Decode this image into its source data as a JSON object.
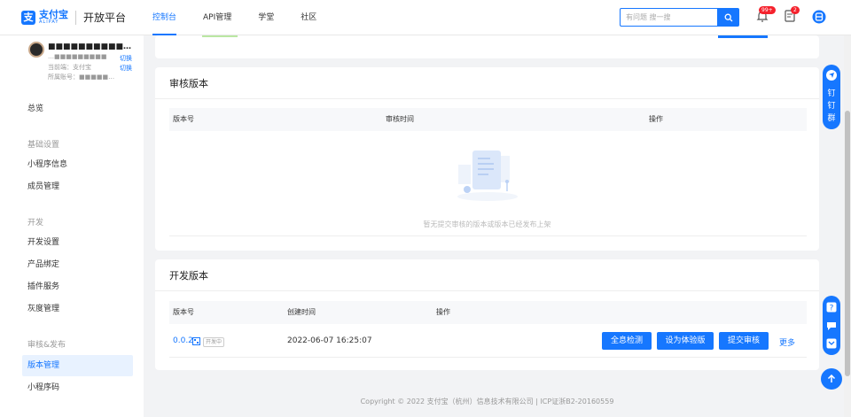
{
  "header": {
    "logo_cn": "支付宝",
    "logo_en": "ALIPAY",
    "platform": "开放平台",
    "nav": [
      "控制台",
      "API管理",
      "学堂",
      "社区"
    ],
    "search_placeholder": "有问题 搜一搜",
    "notification_badge": "99+",
    "message_badge": "2"
  },
  "sidebar": {
    "user_name": "■■■■■■■■■■…",
    "user_sub": "…■■■■■■■■■",
    "current_end_label": "当前端：支付宝",
    "account_label": "所属账号：■■■■■…",
    "switch_label": "切换",
    "overview": "总览",
    "groups": [
      "基础设置",
      "开发",
      "审核&发布"
    ],
    "items_basic": [
      "小程序信息",
      "成员管理"
    ],
    "items_dev": [
      "开发设置",
      "产品绑定",
      "插件服务",
      "灰度管理"
    ],
    "items_release": [
      "版本管理",
      "小程序码"
    ]
  },
  "review_card": {
    "title": "审核版本",
    "columns": [
      "版本号",
      "审核时间",
      "操作"
    ],
    "empty_text": "暂无提交审核的版本或版本已经发布上架"
  },
  "dev_card": {
    "title": "开发版本",
    "columns": [
      "版本号",
      "创建时间",
      "操作"
    ],
    "row": {
      "version": "0.0.2",
      "status": "开发中",
      "created": "2022-06-07 16:25:07",
      "actions": [
        "全息检测",
        "设为体验版",
        "提交审核"
      ],
      "more": "更多"
    }
  },
  "float": {
    "ding_text": [
      "钉",
      "钉",
      "群"
    ]
  },
  "footer": "Copyright © 2022 支付宝（杭州）信息技术有限公司 | ICP证浙B2-20160559",
  "colors": {
    "accent": "#1677ff",
    "badge": "#f5222d"
  }
}
